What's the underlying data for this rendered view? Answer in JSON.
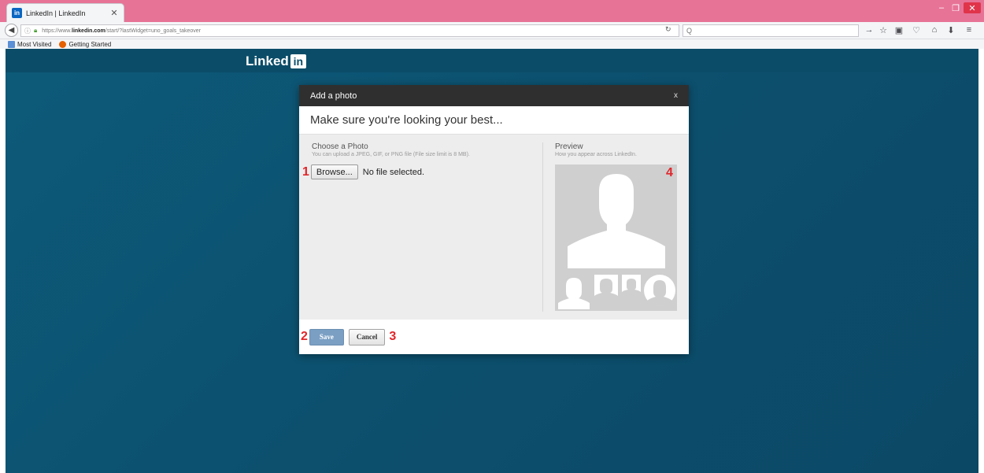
{
  "browser": {
    "tab_title": "LinkedIn | LinkedIn",
    "tab_favicon": "in",
    "url_prefix": "https://www.",
    "url_domain": "linkedin.com",
    "url_path": "/start/?lastWidget=uno_goals_takeover",
    "search_placeholder": "Q",
    "bookmarks": [
      "Most Visited",
      "Getting Started"
    ],
    "window_controls": [
      "–",
      "❐",
      "✕"
    ]
  },
  "linkedin": {
    "logo_text": "Linked",
    "logo_in": "in"
  },
  "dialog": {
    "title": "Add a photo",
    "close_label": "x",
    "subtitle": "Make sure you're looking your best...",
    "choose_title": "Choose a Photo",
    "choose_hint": "You can upload a JPEG, GIF, or PNG file (File size limit is 8 MB).",
    "browse_label": "Browse...",
    "file_status": "No file selected.",
    "preview_title": "Preview",
    "preview_hint": "How you appear across LinkedIn.",
    "save_label": "Save",
    "cancel_label": "Cancel"
  },
  "markers": {
    "m1": "1",
    "m2": "2",
    "m3": "3",
    "m4": "4"
  },
  "colors": {
    "titlebar": "#e77397",
    "page_bg": "#0c5573",
    "dialog_head": "#2f2f2f",
    "marker": "#e0262b"
  }
}
